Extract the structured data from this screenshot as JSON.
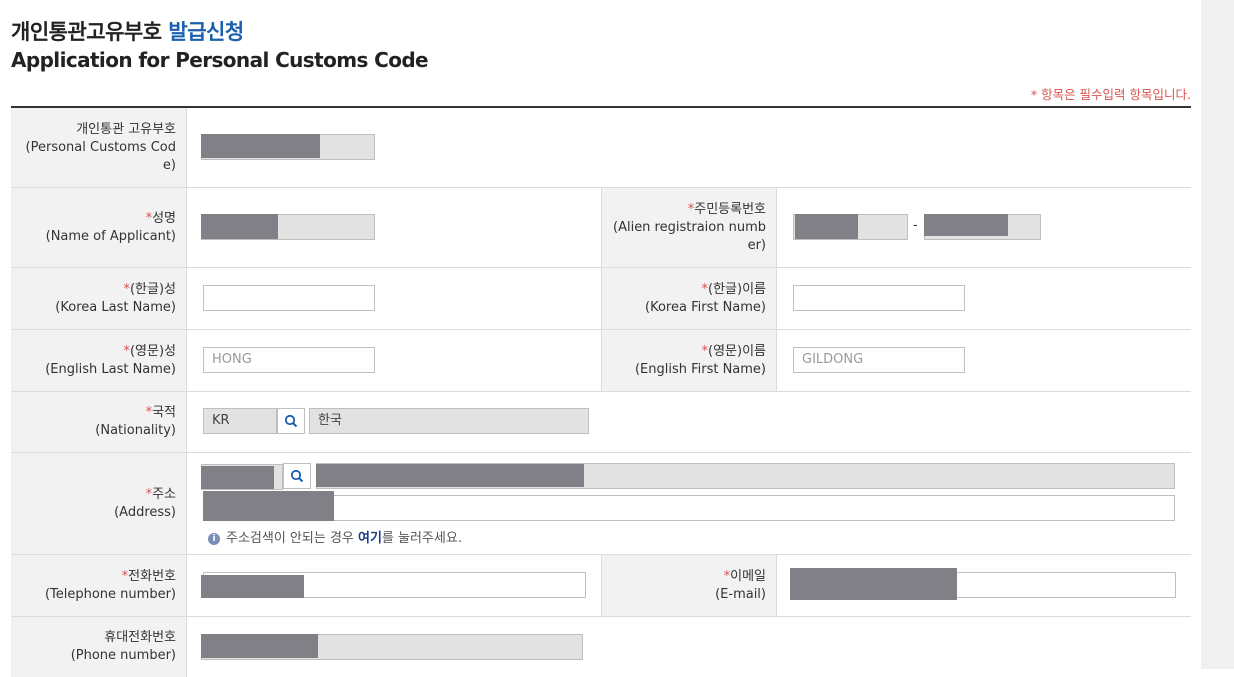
{
  "header": {
    "title_ko": "개인통관고유부호",
    "title_ko_highlight": "발급신청",
    "title_en": "Application for Personal Customs Code",
    "required_note": "* 항목은 필수입력 항목입니다."
  },
  "form": {
    "pcc": {
      "label_ko": "개인통관 고유부호",
      "label_en_1": "(Personal Customs Cod",
      "label_en_2": "e)"
    },
    "name": {
      "star": "*",
      "label_ko": "성명",
      "label_en": "(Name of Applicant)"
    },
    "alien_reg": {
      "star": "*",
      "label_ko": "주민등록번호",
      "label_en_1": "(Alien registraion numb",
      "label_en_2": "er)",
      "separator": "-"
    },
    "korea_last": {
      "star": "*",
      "label_ko": "(한글)성",
      "label_en": "(Korea Last Name)",
      "value": ""
    },
    "korea_first": {
      "star": "*",
      "label_ko": "(한글)이름",
      "label_en": "(Korea First Name)",
      "value": ""
    },
    "english_last": {
      "star": "*",
      "label_ko": "(영문)성",
      "label_en": "(English Last Name)",
      "placeholder": "HONG"
    },
    "english_first": {
      "star": "*",
      "label_ko": "(영문)이름",
      "label_en": "(English First Name)",
      "placeholder": "GILDONG"
    },
    "nationality": {
      "star": "*",
      "label_ko": "국적",
      "label_en": "(Nationality)",
      "code": "KR",
      "name": "한국"
    },
    "address": {
      "star": "*",
      "label_ko": "주소",
      "label_en": "(Address)",
      "hint_pre": "주소검색이 안되는 경우 ",
      "hint_link": "여기",
      "hint_post": "를 눌러주세요."
    },
    "telephone": {
      "star": "*",
      "label_ko": "전화번호",
      "label_en": "(Telephone number)"
    },
    "email": {
      "star": "*",
      "label_ko": "이메일",
      "label_en": "(E-mail)"
    },
    "mobile": {
      "label_ko": "휴대전화번호",
      "label_en": "(Phone number)"
    }
  },
  "colors": {
    "accent": "#1b5fae",
    "required": "#d9534f",
    "label_bg": "#f2f2f2",
    "readonly_bg": "#e2e2e2",
    "redaction": "#808086"
  }
}
